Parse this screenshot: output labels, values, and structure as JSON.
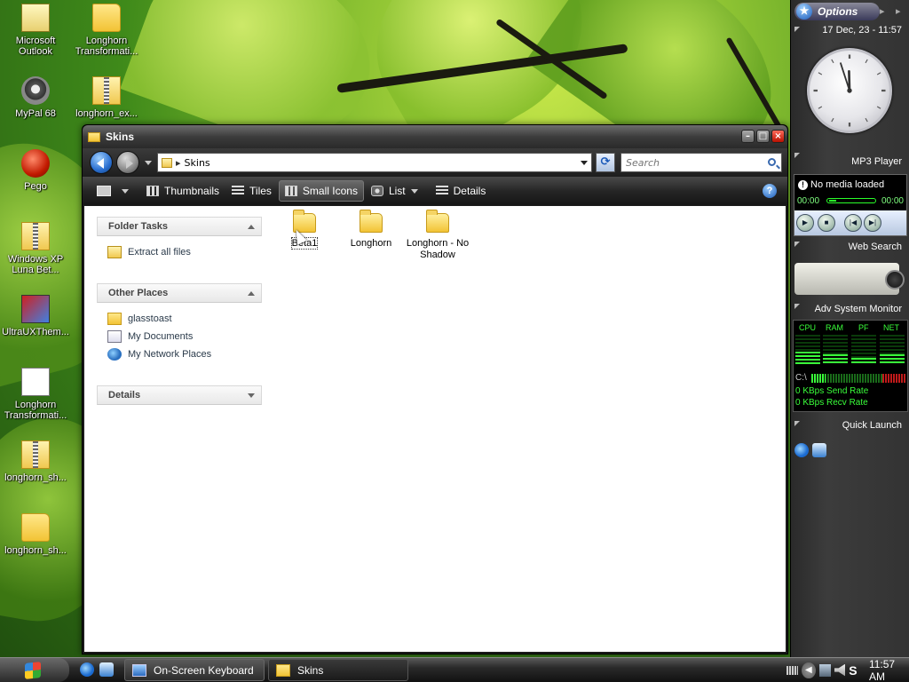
{
  "colors": {
    "window_chrome": "#2a2a2a",
    "accent_blue": "#1a5ab8",
    "monitor_green": "#3aff3a",
    "folder_yellow": "#f2c335"
  },
  "desktop": {
    "icons": [
      {
        "label": "Microsoft Outlook",
        "icon": "outlook-icon"
      },
      {
        "label": "Longhorn Transformati...",
        "icon": "folder-icon"
      },
      {
        "label": "MyPal 68",
        "icon": "raccoon-icon"
      },
      {
        "label": "longhorn_ex...",
        "icon": "zip-icon"
      },
      {
        "label": "Pego",
        "icon": "red-ball-icon"
      },
      {
        "label": "Windows XP Luna Bet...",
        "icon": "zip-icon"
      },
      {
        "label": "UltraUXThem...",
        "icon": "monitor-icon"
      },
      {
        "label": "Longhorn Transformati...",
        "icon": "document-icon"
      },
      {
        "label": "longhorn_sh...",
        "icon": "zip-icon"
      },
      {
        "label": "longhorn_sh...",
        "icon": "folder-icon"
      }
    ]
  },
  "window": {
    "title": "Skins",
    "address": {
      "separator": "▸",
      "path": "Skins"
    },
    "search": {
      "placeholder": "Search"
    },
    "buttons": {
      "minimize": "–",
      "maximize": "□",
      "close": "×",
      "refresh": "⟳",
      "help": "?"
    },
    "toolbar": [
      {
        "label": "Thumbnails",
        "active": false
      },
      {
        "label": "Tiles",
        "active": false
      },
      {
        "label": "Small Icons",
        "active": true
      },
      {
        "label": "List",
        "active": false
      },
      {
        "label": "Details",
        "active": false
      }
    ],
    "panes": [
      {
        "title": "Folder Tasks",
        "expanded": true,
        "items": [
          {
            "label": "Extract all files",
            "icon": "zip-folder-icon"
          }
        ]
      },
      {
        "title": "Other Places",
        "expanded": true,
        "items": [
          {
            "label": "glasstoast",
            "icon": "folder-icon"
          },
          {
            "label": "My Documents",
            "icon": "my-documents-icon"
          },
          {
            "label": "My Network Places",
            "icon": "network-icon"
          }
        ]
      },
      {
        "title": "Details",
        "expanded": false,
        "items": []
      }
    ],
    "files": [
      {
        "name": "Beta1",
        "selected": true
      },
      {
        "name": "Longhorn",
        "selected": false
      },
      {
        "name": "Longhorn - No Shadow",
        "selected": false
      }
    ]
  },
  "sidebar": {
    "options_label": "Options",
    "datetime": "17 Dec, 23 - 11:57",
    "clock": {
      "hours": 11,
      "minutes": 57
    },
    "mp3": {
      "title": "MP3 Player",
      "status": "No media loaded",
      "time_left": "00:00",
      "time_right": "00:00"
    },
    "web_search": {
      "title": "Web Search"
    },
    "sysmon": {
      "title": "Adv System Monitor",
      "headers": [
        "CPU",
        "RAM",
        "PF",
        "NET"
      ],
      "levels": [
        0.45,
        0.35,
        0.25,
        0.35
      ],
      "drive": "C:\\",
      "drive_used_fraction": 0.15,
      "send": "0 KBps Send Rate",
      "recv": "0 KBps Recv Rate"
    },
    "quick_launch": {
      "title": "Quick Launch"
    }
  },
  "taskbar": {
    "tasks": [
      {
        "label": "On-Screen Keyboard",
        "active": false
      },
      {
        "label": "Skins",
        "active": true
      }
    ],
    "time": "11:57 AM"
  }
}
